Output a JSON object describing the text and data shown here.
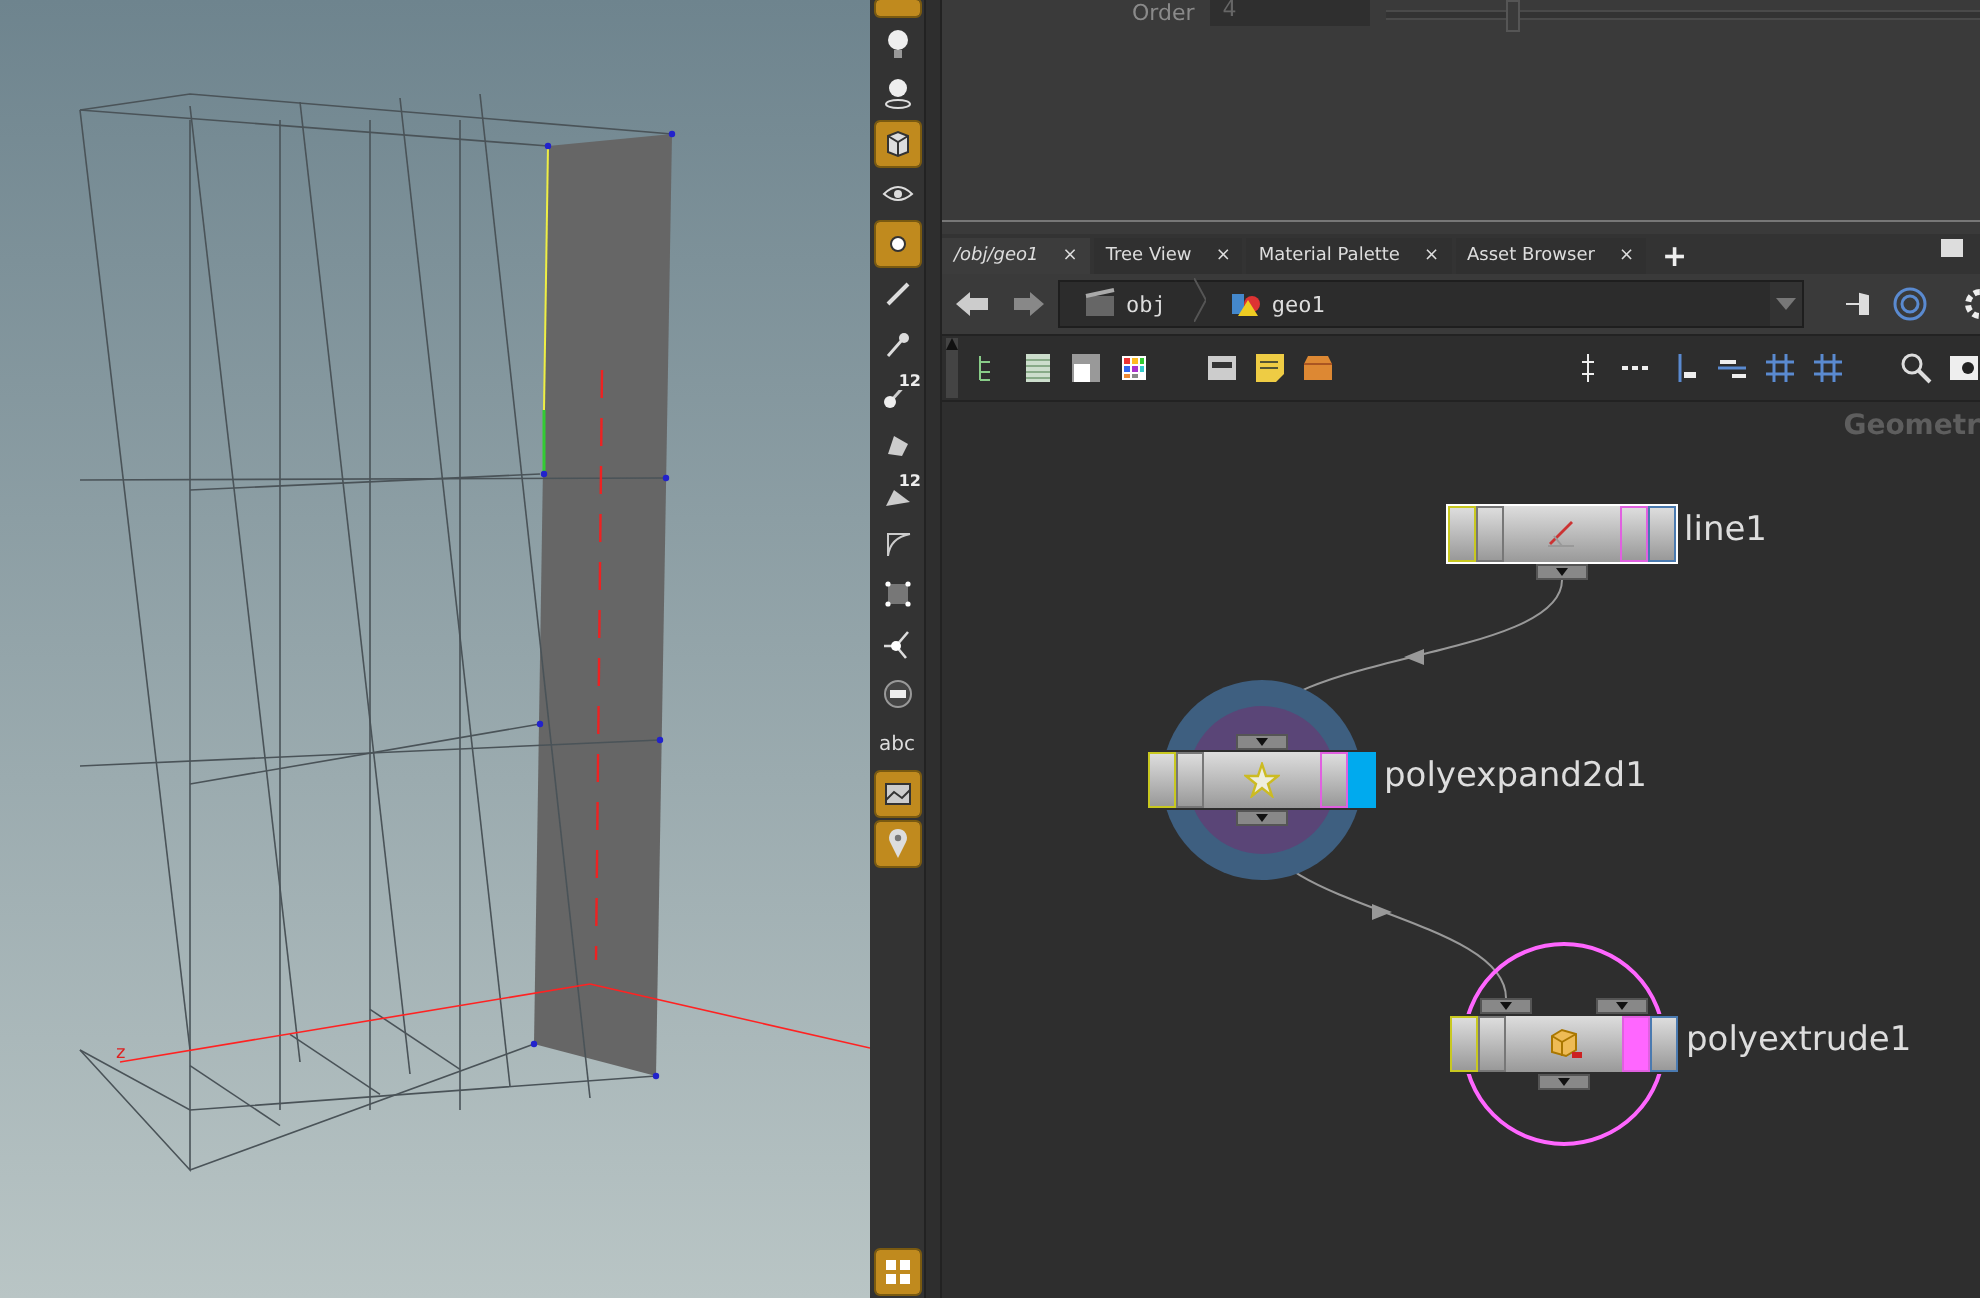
{
  "viewport": {
    "axis_label": "z"
  },
  "shelf_tools": [
    {
      "kind": "cut",
      "on": true
    },
    {
      "kind": "bulb",
      "on": false
    },
    {
      "kind": "bulb-disc",
      "on": false
    },
    {
      "kind": "cube",
      "on": true
    },
    {
      "kind": "eye",
      "on": false
    },
    {
      "kind": "point",
      "on": true
    },
    {
      "kind": "brush",
      "on": false
    },
    {
      "kind": "dropper",
      "on": false
    },
    {
      "kind": "number",
      "on": false,
      "label": "12"
    },
    {
      "kind": "bucket",
      "on": false
    },
    {
      "kind": "number-tri",
      "on": false,
      "label": "12"
    },
    {
      "kind": "curve",
      "on": false
    },
    {
      "kind": "square",
      "on": false
    },
    {
      "kind": "joint",
      "on": false
    },
    {
      "kind": "equals",
      "on": false
    },
    {
      "kind": "text",
      "on": false,
      "label": "abc"
    },
    {
      "kind": "image",
      "on": true
    },
    {
      "kind": "pin",
      "on": true
    },
    {
      "kind": "grid",
      "on": true
    }
  ],
  "parameters": {
    "label": "Order",
    "value": "4"
  },
  "tabs": [
    {
      "label": "/obj/geo1",
      "selected": true,
      "close": "×"
    },
    {
      "label": "Tree View",
      "selected": false,
      "close": "×"
    },
    {
      "label": "Material Palette",
      "selected": false,
      "close": "×"
    },
    {
      "label": "Asset Browser",
      "selected": false,
      "close": "×"
    }
  ],
  "add_tab": "+",
  "path": [
    "obj",
    "geo1"
  ],
  "network": {
    "context_label": "Geometr",
    "nodes": [
      {
        "name": "line1",
        "kind": "line",
        "selected": true,
        "display": false,
        "template": false
      },
      {
        "name": "polyexpand2d1",
        "kind": "star",
        "selected": false,
        "display": true,
        "template": false
      },
      {
        "name": "polyextrude1",
        "kind": "extrude",
        "selected": false,
        "display": false,
        "template": true
      }
    ]
  }
}
